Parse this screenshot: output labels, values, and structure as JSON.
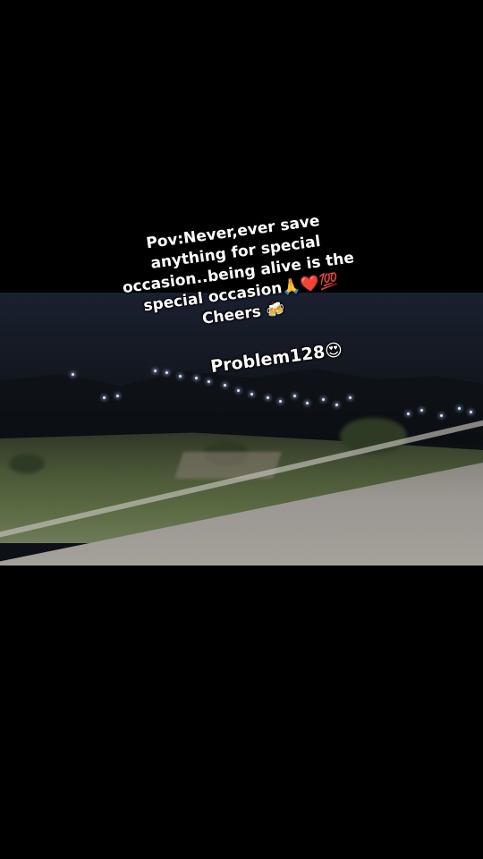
{
  "caption": {
    "lines": [
      "Pov:Never,ever save",
      "anything for special",
      "occasion..being alive is the",
      "special occasion🙏❤️💯",
      "Cheers 🍻"
    ],
    "tag": "Problem128😍"
  }
}
